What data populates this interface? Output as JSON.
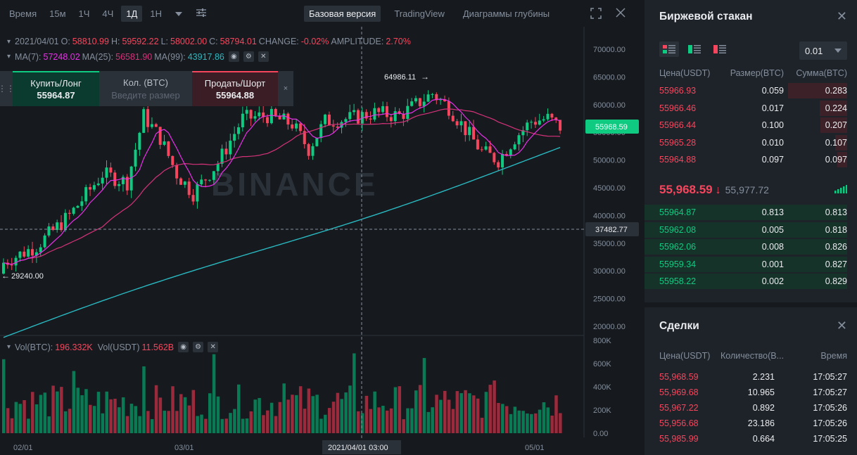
{
  "toolbar": {
    "time_label": "Время",
    "intervals": [
      "15м",
      "1Ч",
      "4Ч",
      "1Д",
      "1Н"
    ],
    "active_interval": "1Д",
    "views": [
      "Базовая версия",
      "TradingView",
      "Диаграммы глубины"
    ],
    "active_view": "Базовая версия"
  },
  "ohlc": {
    "date": "2021/04/01",
    "o_label": "O:",
    "o": "58810.99",
    "h_label": "H:",
    "h": "59592.22",
    "l_label": "L:",
    "l": "58002.00",
    "c_label": "C:",
    "c": "58794.01",
    "change_label": "CHANGE:",
    "change": "-0.02%",
    "amp_label": "AMPLITUDE:",
    "amp": "2.70%"
  },
  "ma": {
    "ma7_label": "MA(7):",
    "ma7": "57248.02",
    "ma25_label": "MA(25):",
    "ma25": "56581.90",
    "ma99_label": "MA(99):",
    "ma99": "43917.86"
  },
  "trade_box": {
    "buy_label": "Купить/Лонг",
    "buy_price": "55964.87",
    "qty_label": "Кол. (BTC)",
    "qty_placeholder": "Введите размер",
    "sell_label": "Продать/Шорт",
    "sell_price": "55964.88"
  },
  "chart": {
    "y_ticks": [
      "70000.00",
      "65000.00",
      "60000.00",
      "55000.00",
      "50000.00",
      "45000.00",
      "40000.00",
      "35000.00",
      "30000.00",
      "25000.00",
      "20000.00"
    ],
    "current_price_tag": "55968.59",
    "crosshair_price_tag": "37482.77",
    "high_marker": "64986.11",
    "low_marker": "29240.00",
    "watermark": "BINANCE",
    "x_ticks": [
      "02/01",
      "03/01",
      "05/01"
    ],
    "crosshair_date": "2021/04/01 03:00",
    "vol_label": "Vol(BTC):",
    "vol_btc": "196.332K",
    "vol_usdt_label": "Vol(USDT)",
    "vol_usdt": "11.562B",
    "vol_ticks": [
      "800K",
      "600K",
      "400K",
      "200K",
      "0.00"
    ],
    "colors": {
      "up": "#0ecb81",
      "down": "#f6465d",
      "ma7": "#e82fe8",
      "ma25": "#d6327a",
      "ma99": "#2ab8c1"
    }
  },
  "chart_data": {
    "type": "candlestick",
    "ma_series": [
      "MA(7)",
      "MA(25)",
      "MA(99)"
    ],
    "ylim": [
      20000,
      70000
    ],
    "volume_ylim": [
      0,
      800000
    ]
  },
  "orderbook": {
    "title": "Биржевой стакан",
    "precision": "0.01",
    "head": [
      "Цена(USDT)",
      "Размер(BTC)",
      "Сумма(BTC)"
    ],
    "asks": [
      {
        "price": "55966.93",
        "size": "0.059",
        "sum": "0.283",
        "depth": 0.6
      },
      {
        "price": "55966.46",
        "size": "0.017",
        "sum": "0.224",
        "depth": 0.28
      },
      {
        "price": "55966.44",
        "size": "0.100",
        "sum": "0.207",
        "depth": 0.27
      },
      {
        "price": "55965.28",
        "size": "0.010",
        "sum": "0.107",
        "depth": 0.12
      },
      {
        "price": "55964.88",
        "size": "0.097",
        "sum": "0.097",
        "depth": 0.1
      }
    ],
    "last_price": "55,968.59",
    "mark_price": "55,977.72",
    "bids": [
      {
        "price": "55964.87",
        "size": "0.813",
        "sum": "0.813"
      },
      {
        "price": "55962.08",
        "size": "0.005",
        "sum": "0.818"
      },
      {
        "price": "55962.06",
        "size": "0.008",
        "sum": "0.826"
      },
      {
        "price": "55959.34",
        "size": "0.001",
        "sum": "0.827"
      },
      {
        "price": "55958.22",
        "size": "0.002",
        "sum": "0.829"
      }
    ]
  },
  "trades": {
    "title": "Сделки",
    "head": [
      "Цена(USDT)",
      "Количество(B...",
      "Время"
    ],
    "rows": [
      {
        "price": "55,968.59",
        "qty": "2.231",
        "time": "17:05:27"
      },
      {
        "price": "55,969.68",
        "qty": "10.965",
        "time": "17:05:27"
      },
      {
        "price": "55,967.22",
        "qty": "0.892",
        "time": "17:05:26"
      },
      {
        "price": "55,956.68",
        "qty": "23.186",
        "time": "17:05:26"
      },
      {
        "price": "55,985.99",
        "qty": "0.664",
        "time": "17:05:25"
      }
    ]
  }
}
